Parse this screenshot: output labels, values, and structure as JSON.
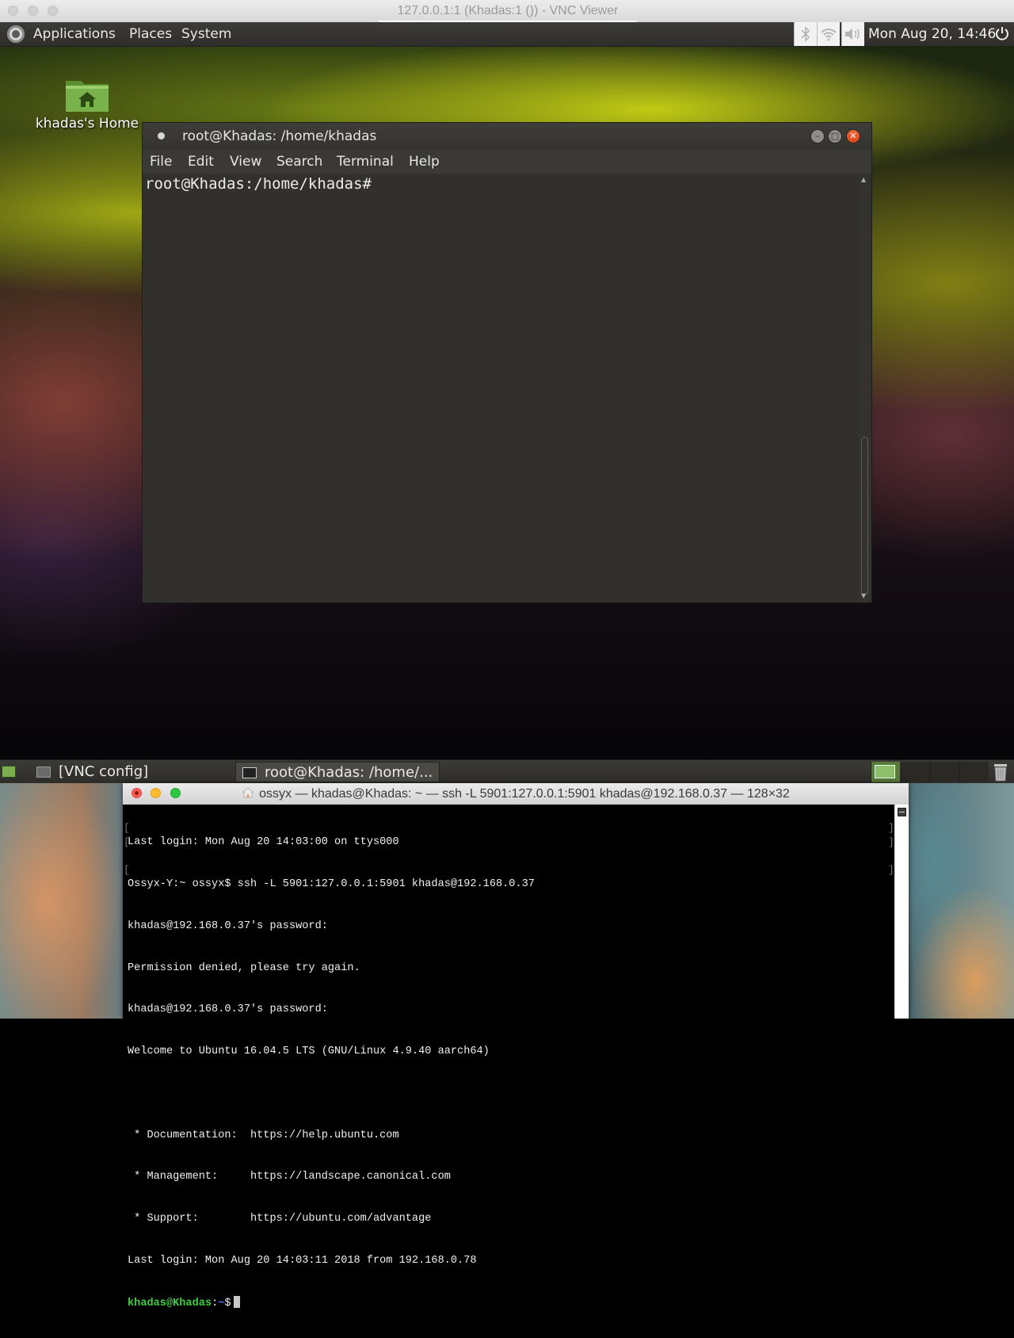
{
  "vnc_window": {
    "title": "127.0.0.1:1 (Khadas:1 ()) - VNC Viewer"
  },
  "top_panel": {
    "menus": [
      "Applications",
      "Places",
      "System"
    ],
    "tray_icons": [
      "bluetooth-icon",
      "wifi-icon",
      "volume-icon"
    ],
    "clock": "Mon Aug 20, 14:46",
    "power_icon": "power-icon"
  },
  "desktop": {
    "icons": [
      {
        "label": "khadas's Home",
        "icon": "home-folder-icon"
      }
    ]
  },
  "mate_terminal": {
    "title": "root@Khadas: /home/khadas",
    "menu": [
      "File",
      "Edit",
      "View",
      "Search",
      "Terminal",
      "Help"
    ],
    "prompt": "root@Khadas:/home/khadas#",
    "window_buttons": [
      "minimize",
      "maximize",
      "close"
    ]
  },
  "bottom_panel": {
    "tasks": [
      {
        "label": "[VNC config]",
        "active": false
      },
      {
        "label": "root@Khadas: /home/...",
        "active": true
      }
    ],
    "workspaces": 4,
    "active_workspace": 1
  },
  "mac_terminal": {
    "title": "ossyx — khadas@Khadas: ~ — ssh -L 5901:127.0.0.1:5901 khadas@192.168.0.37 — 128×32",
    "lines": [
      "Last login: Mon Aug 20 14:03:00 on ttys000",
      "Ossyx-Y:~ ossyx$ ssh -L 5901:127.0.0.1:5901 khadas@192.168.0.37",
      "khadas@192.168.0.37's password:",
      "Permission denied, please try again.",
      "khadas@192.168.0.37's password:",
      "Welcome to Ubuntu 16.04.5 LTS (GNU/Linux 4.9.40 aarch64)",
      "",
      " * Documentation:  https://help.ubuntu.com",
      " * Management:     https://landscape.canonical.com",
      " * Support:        https://ubuntu.com/advantage",
      "Last login: Mon Aug 20 14:03:11 2018 from 192.168.0.78"
    ],
    "prompt_user": "khadas@Khadas",
    "prompt_sep": ":",
    "prompt_path": "~",
    "prompt_symbol": "$"
  },
  "colors": {
    "prompt_green": "#3fce43",
    "prompt_blue": "#4f7cff",
    "mate_close": "#e0502a",
    "panel_bg": "#3c3b37"
  }
}
